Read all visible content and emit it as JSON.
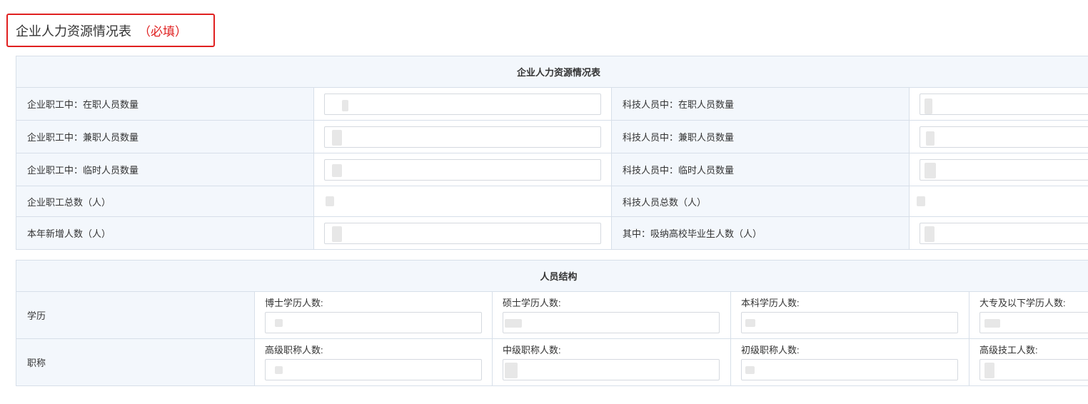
{
  "section": {
    "title": "企业人力资源情况表",
    "required_mark": "（必填）"
  },
  "hr_table": {
    "header": "企业人力资源情况表",
    "rows": [
      {
        "left_label": "企业职工中：在职人员数量",
        "right_label": "科技人员中：在职人员数量",
        "editable": true
      },
      {
        "left_label": "企业职工中：兼职人员数量",
        "right_label": "科技人员中：兼职人员数量",
        "editable": true
      },
      {
        "left_label": "企业职工中：临时人员数量",
        "right_label": "科技人员中：临时人员数量",
        "editable": true
      },
      {
        "left_label": "企业职工总数（人）",
        "right_label": "科技人员总数（人）",
        "editable": false
      },
      {
        "left_label": "本年新增人数（人）",
        "right_label": "其中：吸纳高校毕业生人数（人）",
        "editable": true
      }
    ]
  },
  "structure_table": {
    "header": "人员结构",
    "rows": [
      {
        "label": "学历",
        "fields": [
          "博士学历人数:",
          "硕士学历人数:",
          "本科学历人数:",
          "大专及以下学历人数:"
        ]
      },
      {
        "label": "职称",
        "fields": [
          "高级职称人数:",
          "中级职称人数:",
          "初级职称人数:",
          "高级技工人数:"
        ]
      }
    ]
  },
  "colors": {
    "accent_red": "#e02020",
    "header_bg": "#f3f7fc",
    "border": "#d7dfe9"
  }
}
